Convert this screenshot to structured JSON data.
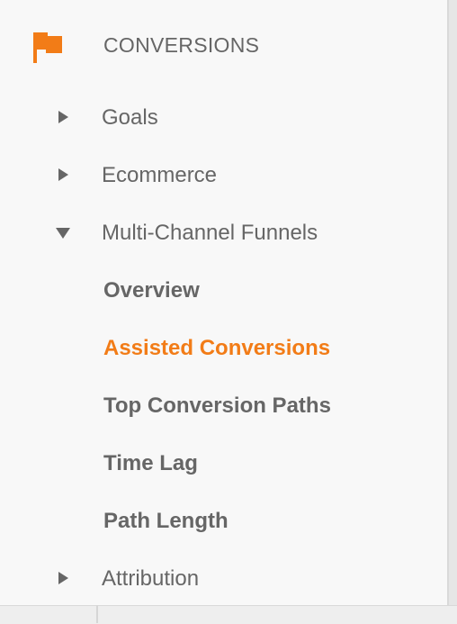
{
  "section": {
    "title": "CONVERSIONS",
    "icon": "flag-icon",
    "accent_color": "#f27c17"
  },
  "nav": {
    "goals": {
      "label": "Goals",
      "expanded": false
    },
    "ecommerce": {
      "label": "Ecommerce",
      "expanded": false
    },
    "multi_channel_funnels": {
      "label": "Multi-Channel Funnels",
      "expanded": true,
      "children": [
        {
          "label": "Overview",
          "active": false
        },
        {
          "label": "Assisted Conversions",
          "active": true
        },
        {
          "label": "Top Conversion Paths",
          "active": false
        },
        {
          "label": "Time Lag",
          "active": false
        },
        {
          "label": "Path Length",
          "active": false
        }
      ]
    },
    "attribution": {
      "label": "Attribution",
      "expanded": false
    }
  },
  "colors": {
    "text": "#666666",
    "active": "#f27c17",
    "background": "#f8f8f8"
  }
}
